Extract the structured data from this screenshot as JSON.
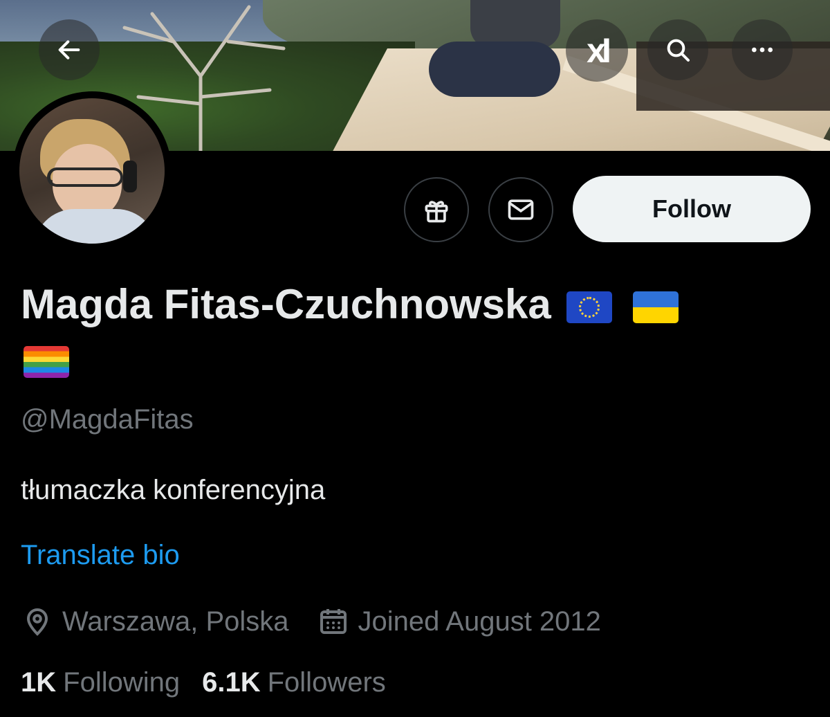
{
  "header": {
    "back_icon": "arrow-left-icon",
    "grok_label": "xI",
    "search_icon": "search-icon",
    "more_icon": "more-horizontal-icon"
  },
  "actions": {
    "gift_icon": "gift-icon",
    "message_icon": "envelope-icon",
    "follow_label": "Follow"
  },
  "profile": {
    "name": "Magda Fitas-Czuchnowska",
    "flags": [
      "EU flag",
      "Ukraine flag",
      "Rainbow flag"
    ],
    "handle": "@MagdaFitas",
    "bio": "tłumaczka konferencyjna",
    "translate_label": "Translate bio",
    "location": "Warszawa, Polska",
    "joined": "Joined August 2012"
  },
  "stats": {
    "following_count": "1K",
    "following_label": "Following",
    "followers_count": "6.1K",
    "followers_label": "Followers"
  },
  "colors": {
    "background": "#000000",
    "text": "#e7e9ea",
    "muted": "#71767b",
    "link": "#1d9bf0",
    "follow_bg": "#eff3f4"
  }
}
